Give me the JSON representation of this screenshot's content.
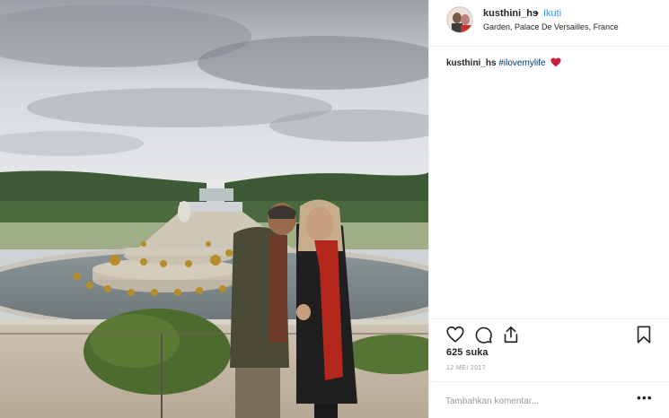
{
  "header": {
    "username": "kusthini_hs",
    "separator": "•",
    "follow_label": "Ikuti",
    "location": "Garden, Palace De Versailles, France"
  },
  "caption": {
    "username": "kusthini_hs",
    "hashtag": "#ilovemylife",
    "emoji": "heart-emoji"
  },
  "actions": {
    "like_icon": "heart-icon",
    "comment_icon": "comment-icon",
    "share_icon": "share-icon",
    "save_icon": "bookmark-icon"
  },
  "likes_text": "625 suka",
  "date_text": "12 MEI 2017",
  "comment": {
    "placeholder": "Tambahkan komentar...",
    "more_icon": "more-options-icon"
  },
  "colors": {
    "follow_blue": "#3897f0",
    "hashtag_blue": "#003569",
    "heart_red": "#c8233a",
    "border": "#efefef"
  }
}
